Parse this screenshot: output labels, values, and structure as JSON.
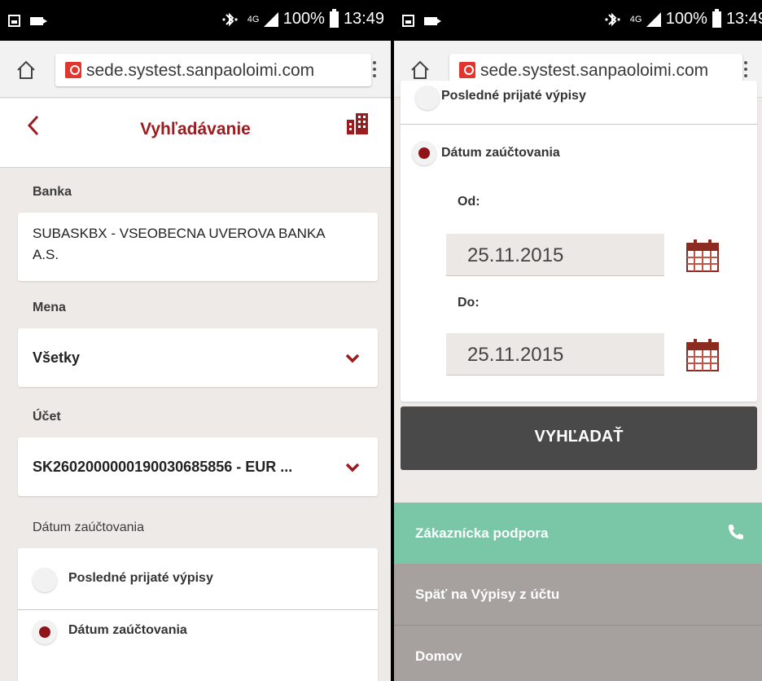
{
  "statusbar": {
    "network": "4G",
    "battery": "100%",
    "time": "13:49"
  },
  "browser": {
    "url": "sede.systest.sanpaoloimi.com"
  },
  "left": {
    "header": {
      "title": "Vyhľadávanie"
    },
    "bank": {
      "label": "Banka",
      "value_line1": "SUBASKBX - VSEOBECNA UVEROVA BANKA",
      "value_line2": "A.S."
    },
    "currency": {
      "label": "Mena",
      "selected": "Všetky"
    },
    "account": {
      "label": "Účet",
      "selected": "SK2602000000190030685856 - EUR ..."
    },
    "posting_date": {
      "label": "Dátum zaúčtovania",
      "options": [
        {
          "label": "Posledné prijaté výpisy",
          "checked": false
        },
        {
          "label": "Dátum zaúčtovania",
          "checked": true
        }
      ]
    }
  },
  "right": {
    "options": [
      {
        "label": "Posledné prijaté výpisy",
        "checked": false
      },
      {
        "label": "Dátum zaúčtovania",
        "checked": true
      }
    ],
    "from": {
      "label": "Od:",
      "value": "25.11.2015"
    },
    "to": {
      "label": "Do:",
      "value": "25.11.2015"
    },
    "search_button": "VYHĽADAŤ",
    "footer": {
      "support": "Zákaznícka podpora",
      "back": "Späť na Výpisy z účtu",
      "home": "Domov"
    }
  },
  "colors": {
    "brand_red": "#9b1b1e",
    "support_green": "#7ac7a7",
    "footer_gray": "#a6a09f",
    "button_dark": "#494949"
  },
  "icons": [
    "image-icon",
    "video-icon",
    "home-icon",
    "lock-icon",
    "menu-icon",
    "back-icon",
    "bank-icon",
    "chevron-down-icon",
    "calendar-icon",
    "phone-icon"
  ]
}
